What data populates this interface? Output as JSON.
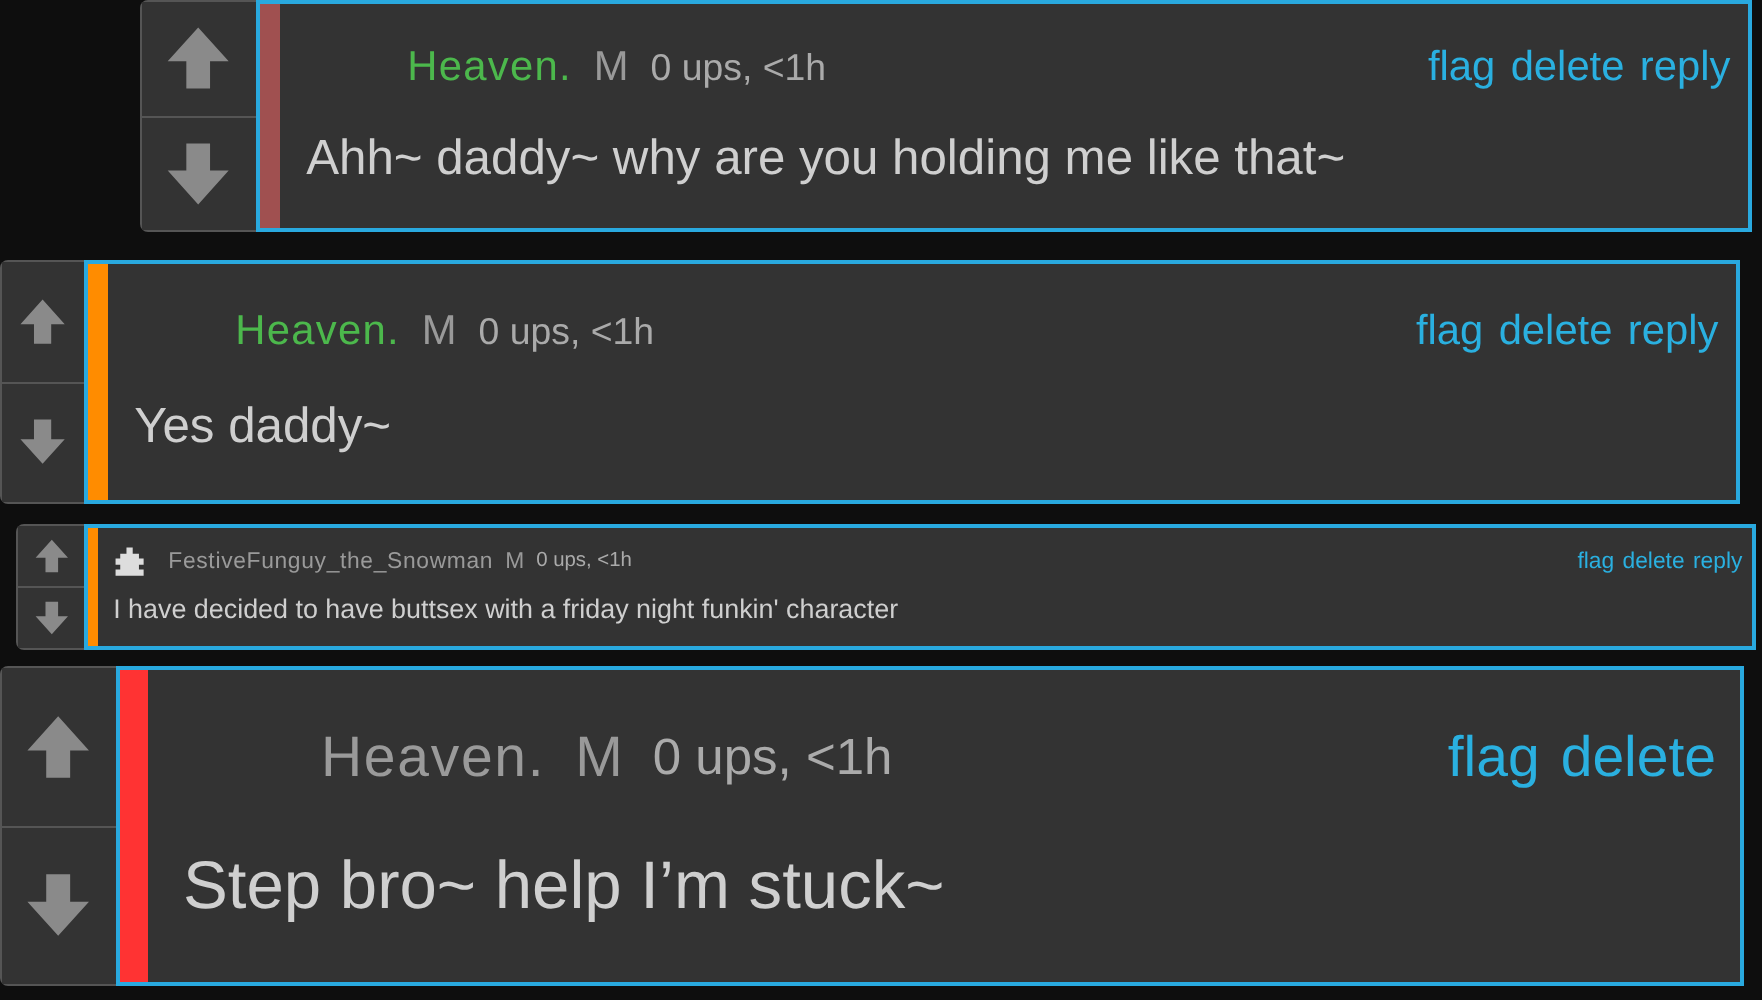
{
  "comments": [
    {
      "username": "Heaven.",
      "username_highlighted": true,
      "avatar": false,
      "badge": "M",
      "meta": "0 ups, <1h",
      "actions": [
        "flag",
        "delete",
        "reply"
      ],
      "text": "Ahh~ daddy~ why are you holding me like that~",
      "color": "#a05050"
    },
    {
      "username": "Heaven.",
      "username_highlighted": true,
      "avatar": false,
      "badge": "M",
      "meta": "0 ups, <1h",
      "actions": [
        "flag",
        "delete",
        "reply"
      ],
      "text": "Yes daddy~",
      "color": "#ff8c00"
    },
    {
      "username": "FestiveFunguy_the_Snowman",
      "username_highlighted": false,
      "avatar": true,
      "badge": "M",
      "meta": "0 ups, <1h",
      "actions": [
        "flag",
        "delete",
        "reply"
      ],
      "text": "I have decided to have buttsex with a friday night funkin' character",
      "color": "#ff8c00"
    },
    {
      "username": "Heaven.",
      "username_highlighted": false,
      "avatar": false,
      "badge": "M",
      "meta": "0 ups, <1h",
      "actions": [
        "flag",
        "delete"
      ],
      "text": "Step bro~ help I’m stuck~",
      "color": "#ff3333"
    }
  ]
}
